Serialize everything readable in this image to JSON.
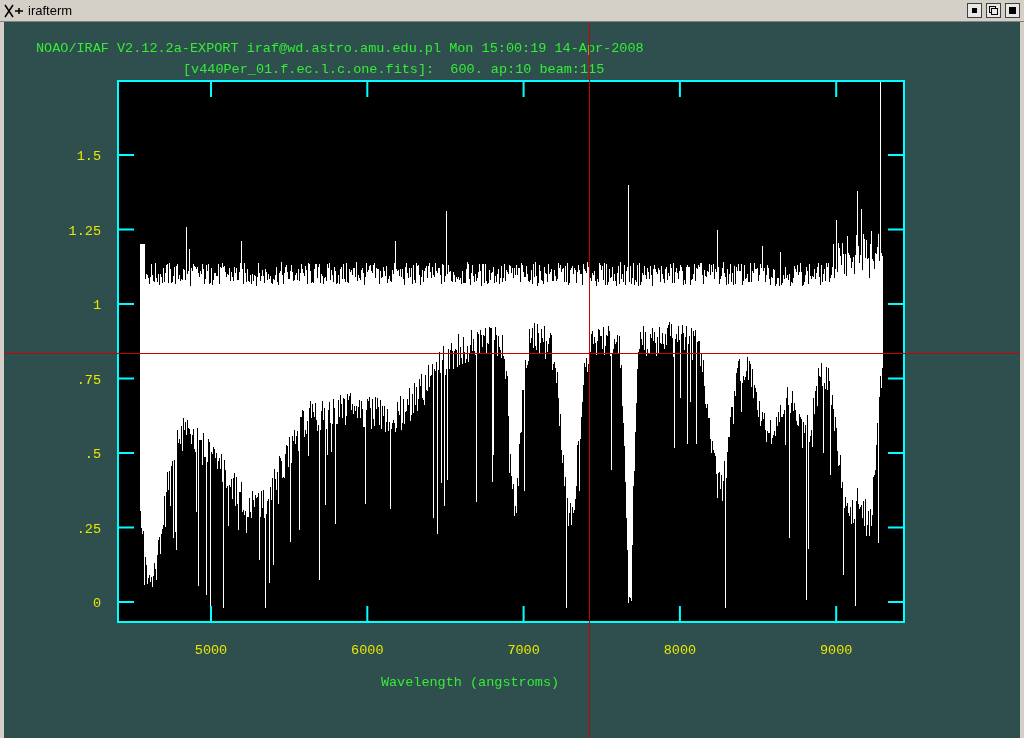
{
  "window": {
    "title": "irafterm"
  },
  "header": {
    "title": "NOAO/IRAF V2.12.2a-EXPORT iraf@wd.astro.amu.edu.pl Mon 15:00:19 14-Apr-2008",
    "subtitle": "[v440Per_01.f.ec.l.c.one.fits]:  600. ap:10 beam:115"
  },
  "plot": {
    "yticks": [
      "1.5",
      "1.25",
      "1",
      ".75",
      ".5",
      ".25",
      "0"
    ],
    "xticks": [
      "5000",
      "6000",
      "7000",
      "8000",
      "9000"
    ],
    "xlabel": "Wavelength (angstroms)"
  }
}
